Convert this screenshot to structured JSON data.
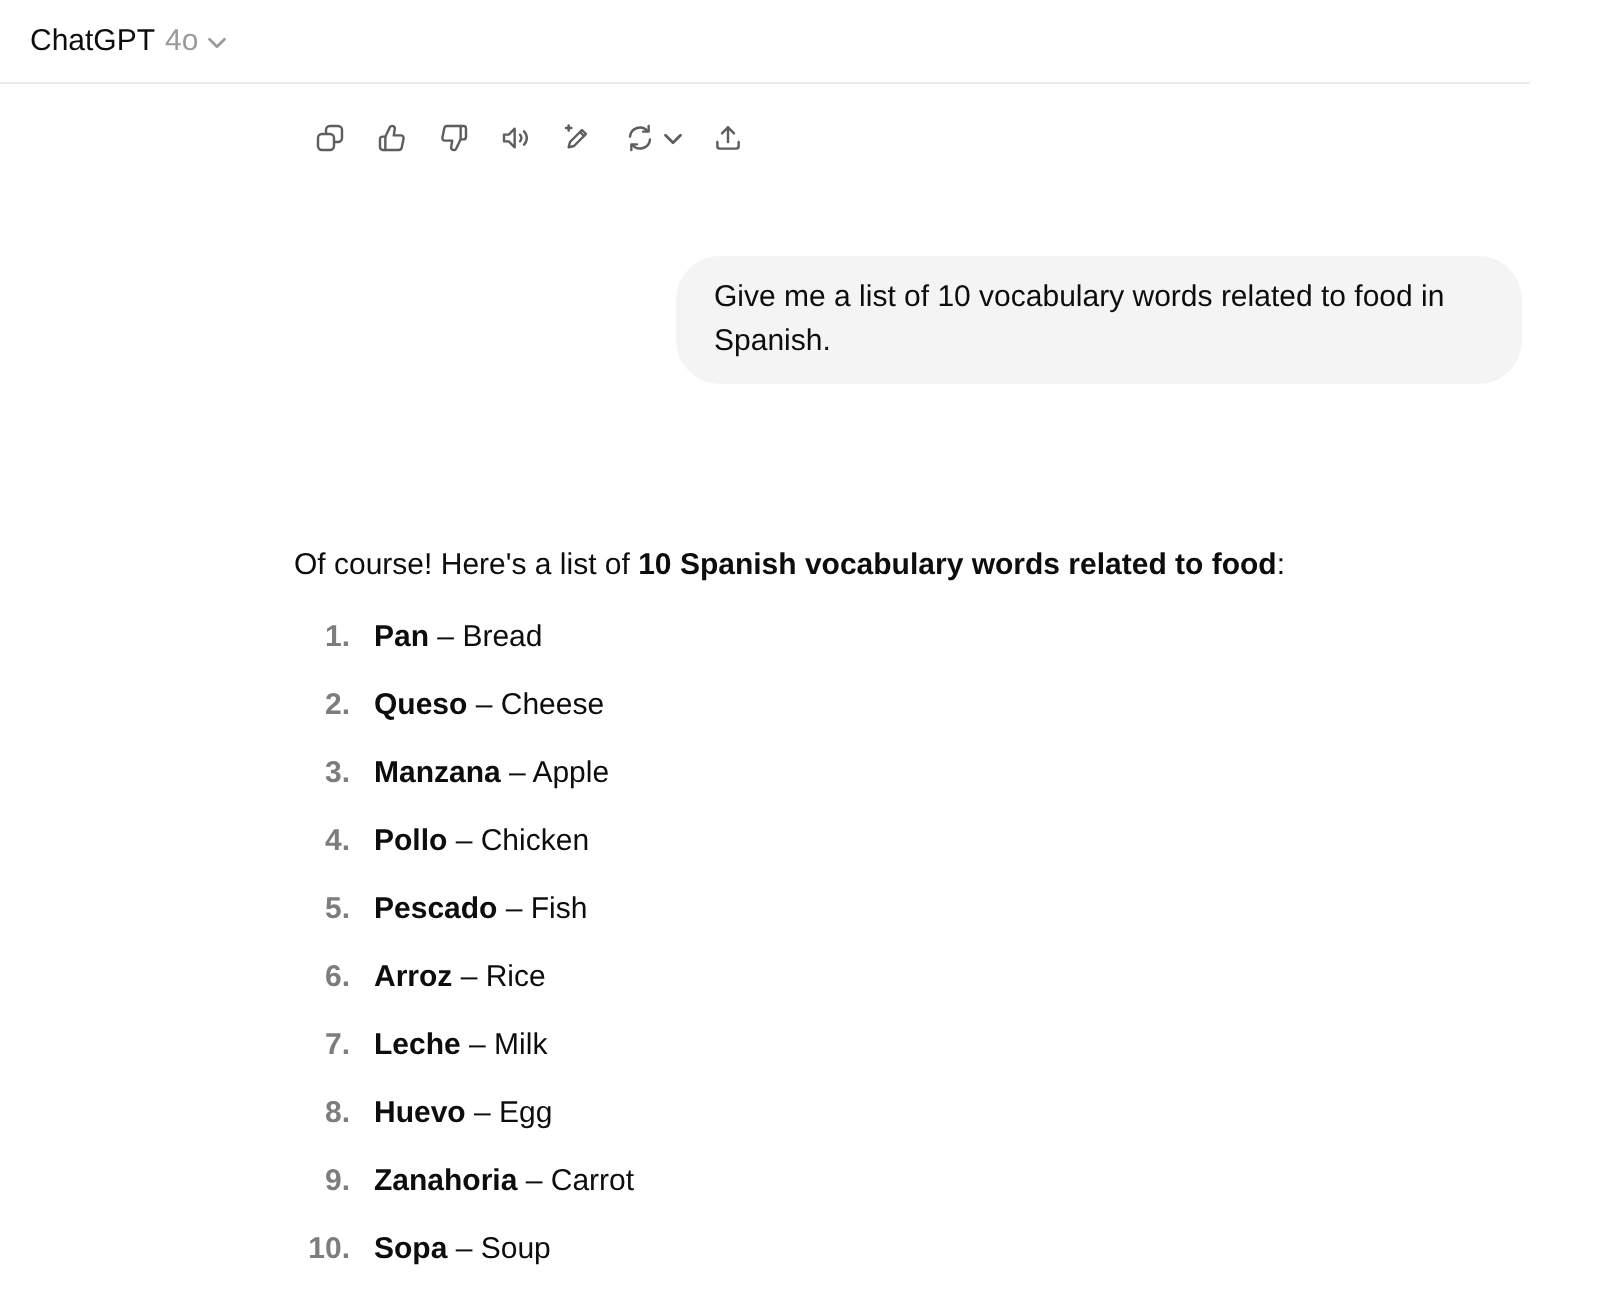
{
  "header": {
    "title": "ChatGPT",
    "model": "4o"
  },
  "messages": [
    {
      "kind": "user",
      "text": "Give me a list of 10 vocabulary words related to food in Spanish."
    },
    {
      "kind": "assistant",
      "intro": "Of course! Here's a list of **10 Spanish vocabulary words related to food**:",
      "items": [
        {
          "number": "1.",
          "text": "**Pan** – Bread"
        },
        {
          "number": "2.",
          "text": "**Queso** – Cheese"
        },
        {
          "number": "3.",
          "text": "**Manzana** – Apple"
        },
        {
          "number": "4.",
          "text": "**Pollo** – Chicken"
        },
        {
          "number": "5.",
          "text": "**Pescado** – Fish"
        },
        {
          "number": "6.",
          "text": "**Arroz** – Rice"
        },
        {
          "number": "7.",
          "text": "**Leche** – Milk"
        },
        {
          "number": "8.",
          "text": "**Huevo** – Egg"
        },
        {
          "number": "9.",
          "text": "**Zanahoria** – Carrot"
        },
        {
          "number": "10.",
          "text": "**Sopa** – Soup"
        }
      ]
    }
  ]
}
